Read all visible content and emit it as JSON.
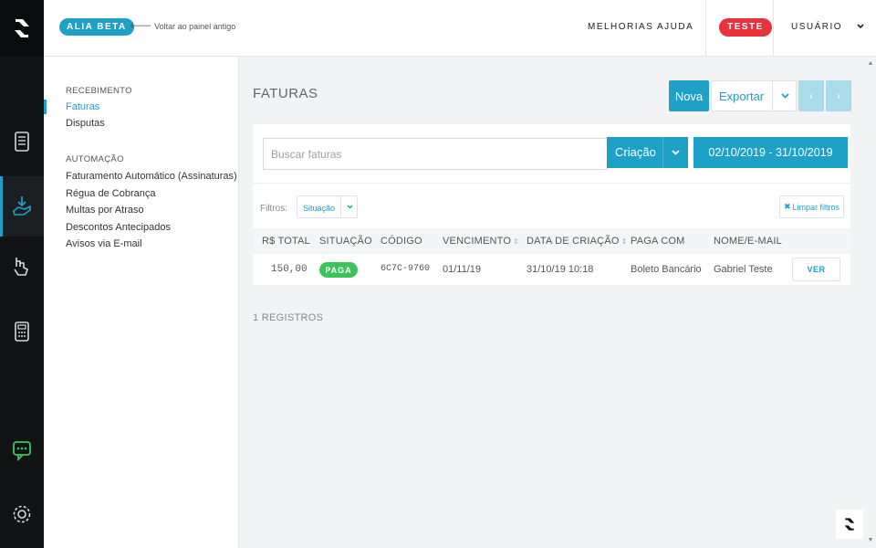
{
  "topbar": {
    "beta_label": "ALIA BETA",
    "back_link": "Voltar ao painel antigo",
    "nav_improvements": "MELHORIAS",
    "nav_help": "AJUDA",
    "env_badge": "TESTE",
    "user_label": "USUÁRIO"
  },
  "rail": {
    "icons": [
      "logo-icon",
      "document-icon",
      "receive-money-icon",
      "payment-hand-icon",
      "calculator-icon",
      "chat-support-icon",
      "settings-gear-icon"
    ],
    "active_index": 2
  },
  "sidebar": {
    "section_receiving": "RECEBIMENTO",
    "items_receiving": [
      {
        "label": "Faturas",
        "active": true
      },
      {
        "label": "Disputas",
        "active": false
      }
    ],
    "section_automation": "AUTOMAÇÃO",
    "items_automation": [
      {
        "label": "Faturamento Automático (Assinaturas)"
      },
      {
        "label": "Régua de Cobrança"
      },
      {
        "label": "Multas por Atraso"
      },
      {
        "label": "Descontos Antecipados"
      },
      {
        "label": "Avisos via E-mail"
      }
    ]
  },
  "main": {
    "title": "FATURAS",
    "new_button": "Nova",
    "export_button": "Exportar",
    "prev_page": "‹",
    "next_page": "›",
    "search_placeholder": "Buscar faturas",
    "date_field": "Criação",
    "date_range": "02/10/2019 - 31/10/2019",
    "filters_label": "Filtros:",
    "filter_status": "Situação",
    "clear_filters": "Limpar filtros",
    "table": {
      "headers": [
        "R$ TOTAL",
        "SITUAÇÃO",
        "CÓDIGO",
        "VENCIMENTO",
        "DATA DE CRIAÇÃO",
        "PAGA COM",
        "NOME/E-MAIL"
      ],
      "rows": [
        {
          "total": "150,00",
          "status": "PAGA",
          "code": "6C7C-9760",
          "due": "01/11/19",
          "created": "31/10/19 10:18",
          "paid_with": "Boleto Bancário",
          "name": "Gabriel Teste",
          "action": "VER"
        }
      ]
    },
    "records": "1 REGISTROS"
  },
  "colors": {
    "accent": "#1ea0c7",
    "danger": "#e8323c",
    "success": "#3cc45c",
    "rail_bg": "#111315",
    "rail_green_icon": "#3cc45c"
  }
}
